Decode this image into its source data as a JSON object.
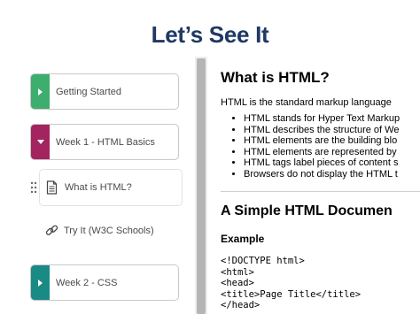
{
  "slide": {
    "title": "Let’s See It"
  },
  "outline": {
    "items": [
      {
        "label": "Getting Started",
        "color": "#3dae6e",
        "state": "collapsed"
      },
      {
        "label": "Week 1 - HTML Basics",
        "color": "#a3245e",
        "state": "expanded"
      },
      {
        "label": "Week 2 - CSS",
        "color": "#1a8a84",
        "state": "collapsed"
      }
    ],
    "sub_items": [
      {
        "label": "What is HTML?",
        "icon": "document-icon",
        "active": true
      },
      {
        "label": "Try It (W3C Schools)",
        "icon": "link-icon",
        "active": false
      }
    ]
  },
  "content": {
    "heading": "What is HTML?",
    "intro": "HTML is the standard markup language",
    "bullets": [
      "HTML stands for Hyper Text Markup",
      "HTML describes the structure of We",
      "HTML elements are the building blo",
      "HTML elements are represented by",
      "HTML tags label pieces of content s",
      "Browsers do not display the HTML t"
    ],
    "section_heading": "A Simple HTML Documen",
    "example_label": "Example",
    "code_lines": [
      "<!DOCTYPE html>",
      "<html>",
      "<head>",
      "<title>Page Title</title>",
      "</head>"
    ]
  }
}
